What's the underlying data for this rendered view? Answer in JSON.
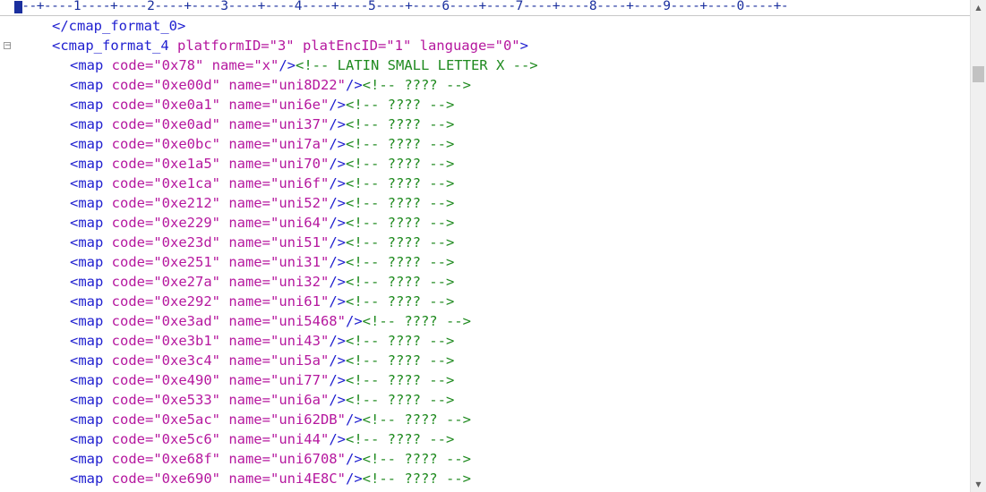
{
  "ruler": {
    "text": "---+----1----+----2----+----3----+----4----+----5----+----6----+----7----+----8----+----9----+----0----+-"
  },
  "lines": {
    "close_fmt0": {
      "tag": "</cmap_format_0>"
    },
    "open_fmt4": {
      "tag_open": "<cmap_format_4",
      "a1": " platformID=",
      "v1": "\"3\"",
      "a2": " platEncID=",
      "v2": "\"1\"",
      "a3": " language=",
      "v3": "\"0\"",
      "tag_close": ">"
    },
    "maps": [
      {
        "code": "\"0x78\"",
        "name": "\"x\"",
        "comment": "<!-- LATIN SMALL LETTER X -->"
      },
      {
        "code": "\"0xe00d\"",
        "name": "\"uni8D22\"",
        "comment": "<!-- ???? -->"
      },
      {
        "code": "\"0xe0a1\"",
        "name": "\"uni6e\"",
        "comment": "<!-- ???? -->"
      },
      {
        "code": "\"0xe0ad\"",
        "name": "\"uni37\"",
        "comment": "<!-- ???? -->"
      },
      {
        "code": "\"0xe0bc\"",
        "name": "\"uni7a\"",
        "comment": "<!-- ???? -->"
      },
      {
        "code": "\"0xe1a5\"",
        "name": "\"uni70\"",
        "comment": "<!-- ???? -->"
      },
      {
        "code": "\"0xe1ca\"",
        "name": "\"uni6f\"",
        "comment": "<!-- ???? -->"
      },
      {
        "code": "\"0xe212\"",
        "name": "\"uni52\"",
        "comment": "<!-- ???? -->"
      },
      {
        "code": "\"0xe229\"",
        "name": "\"uni64\"",
        "comment": "<!-- ???? -->"
      },
      {
        "code": "\"0xe23d\"",
        "name": "\"uni51\"",
        "comment": "<!-- ???? -->"
      },
      {
        "code": "\"0xe251\"",
        "name": "\"uni31\"",
        "comment": "<!-- ???? -->"
      },
      {
        "code": "\"0xe27a\"",
        "name": "\"uni32\"",
        "comment": "<!-- ???? -->"
      },
      {
        "code": "\"0xe292\"",
        "name": "\"uni61\"",
        "comment": "<!-- ???? -->"
      },
      {
        "code": "\"0xe3ad\"",
        "name": "\"uni5468\"",
        "comment": "<!-- ???? -->"
      },
      {
        "code": "\"0xe3b1\"",
        "name": "\"uni43\"",
        "comment": "<!-- ???? -->"
      },
      {
        "code": "\"0xe3c4\"",
        "name": "\"uni5a\"",
        "comment": "<!-- ???? -->"
      },
      {
        "code": "\"0xe490\"",
        "name": "\"uni77\"",
        "comment": "<!-- ???? -->"
      },
      {
        "code": "\"0xe533\"",
        "name": "\"uni6a\"",
        "comment": "<!-- ???? -->"
      },
      {
        "code": "\"0xe5ac\"",
        "name": "\"uni62DB\"",
        "comment": "<!-- ???? -->"
      },
      {
        "code": "\"0xe5c6\"",
        "name": "\"uni44\"",
        "comment": "<!-- ???? -->"
      },
      {
        "code": "\"0xe68f\"",
        "name": "\"uni6708\"",
        "comment": "<!-- ???? -->"
      },
      {
        "code": "\"0xe690\"",
        "name": "\"uni4E8C\"",
        "comment": "<!-- ???? -->"
      }
    ],
    "map_tag": "<map",
    "code_attr": " code=",
    "name_attr": " name=",
    "self_close": "/>"
  },
  "icons": {
    "fold": "minus-in-box",
    "scroll_up": "up-triangle",
    "scroll_down": "down-triangle"
  },
  "colors": {
    "tag": "#2020d0",
    "attribute": "#b5179e",
    "comment": "#1f8a1f",
    "ruler": "#1a2f9e"
  }
}
